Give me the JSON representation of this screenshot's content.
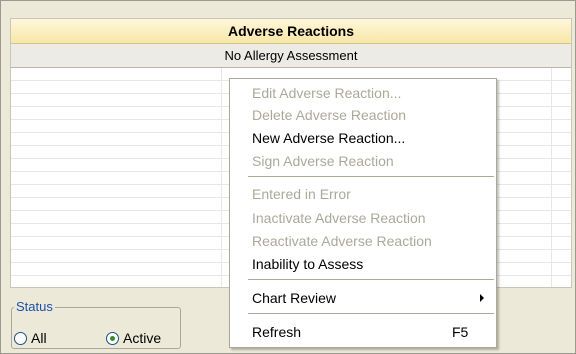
{
  "panel": {
    "title": "Adverse Reactions",
    "subtitle": "No Allergy Assessment"
  },
  "status": {
    "title": "Status",
    "options": [
      {
        "label": "All",
        "selected": false
      },
      {
        "label": "Active",
        "selected": true
      }
    ]
  },
  "context_menu": {
    "items": [
      {
        "label": "Edit Adverse Reaction...",
        "enabled": false
      },
      {
        "label": "Delete Adverse Reaction",
        "enabled": false
      },
      {
        "label": "New Adverse Reaction...",
        "enabled": true
      },
      {
        "label": "Sign Adverse Reaction",
        "enabled": false
      },
      {
        "label": "Entered in Error",
        "enabled": false
      },
      {
        "label": "Inactivate Adverse Reaction",
        "enabled": false
      },
      {
        "label": "Reactivate Adverse Reaction",
        "enabled": false
      },
      {
        "label": "Inability to Assess",
        "enabled": true
      },
      {
        "label": "Chart Review",
        "enabled": true,
        "submenu": true
      },
      {
        "label": "Refresh",
        "enabled": true,
        "shortcut": "F5"
      }
    ]
  },
  "colors": {
    "header_bg": "#f7e7a8",
    "disabled_text": "#aca899",
    "status_label": "#1f4fa8",
    "radio_dot": "#3a8a2e"
  }
}
